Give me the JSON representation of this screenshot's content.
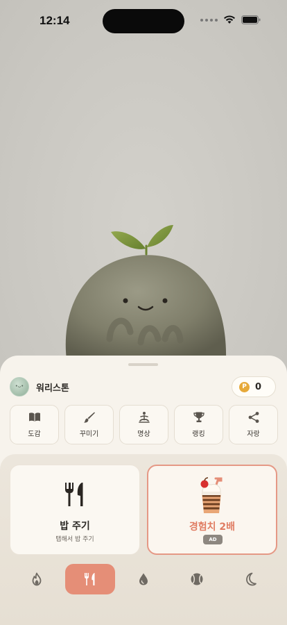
{
  "status_bar": {
    "time": "12:14"
  },
  "pet": {
    "name": "워리스톤"
  },
  "points": {
    "badge": "P",
    "value": "0"
  },
  "menu": [
    {
      "icon": "book-icon",
      "label": "도감"
    },
    {
      "icon": "brush-icon",
      "label": "꾸미기"
    },
    {
      "icon": "meditation-icon",
      "label": "명상"
    },
    {
      "icon": "trophy-icon",
      "label": "랭킹"
    },
    {
      "icon": "share-icon",
      "label": "자랑"
    }
  ],
  "actions": {
    "feed": {
      "title": "밥 주기",
      "subtitle": "탭해서 밥 주기",
      "icon": "fork-knife-icon"
    },
    "xp_boost": {
      "title": "경험치 2배",
      "badge": "AD",
      "icon": "milkshake-icon"
    }
  },
  "tabs": [
    {
      "icon": "flame-icon",
      "active": false
    },
    {
      "icon": "fork-knife-icon",
      "active": true
    },
    {
      "icon": "water-drop-icon",
      "active": false
    },
    {
      "icon": "ball-icon",
      "active": false
    },
    {
      "icon": "moon-icon",
      "active": false
    }
  ],
  "colors": {
    "accent": "#e58e77",
    "xp_text": "#e07c62",
    "coin": "#e6a93a",
    "sheet": "#f7f3ec"
  }
}
